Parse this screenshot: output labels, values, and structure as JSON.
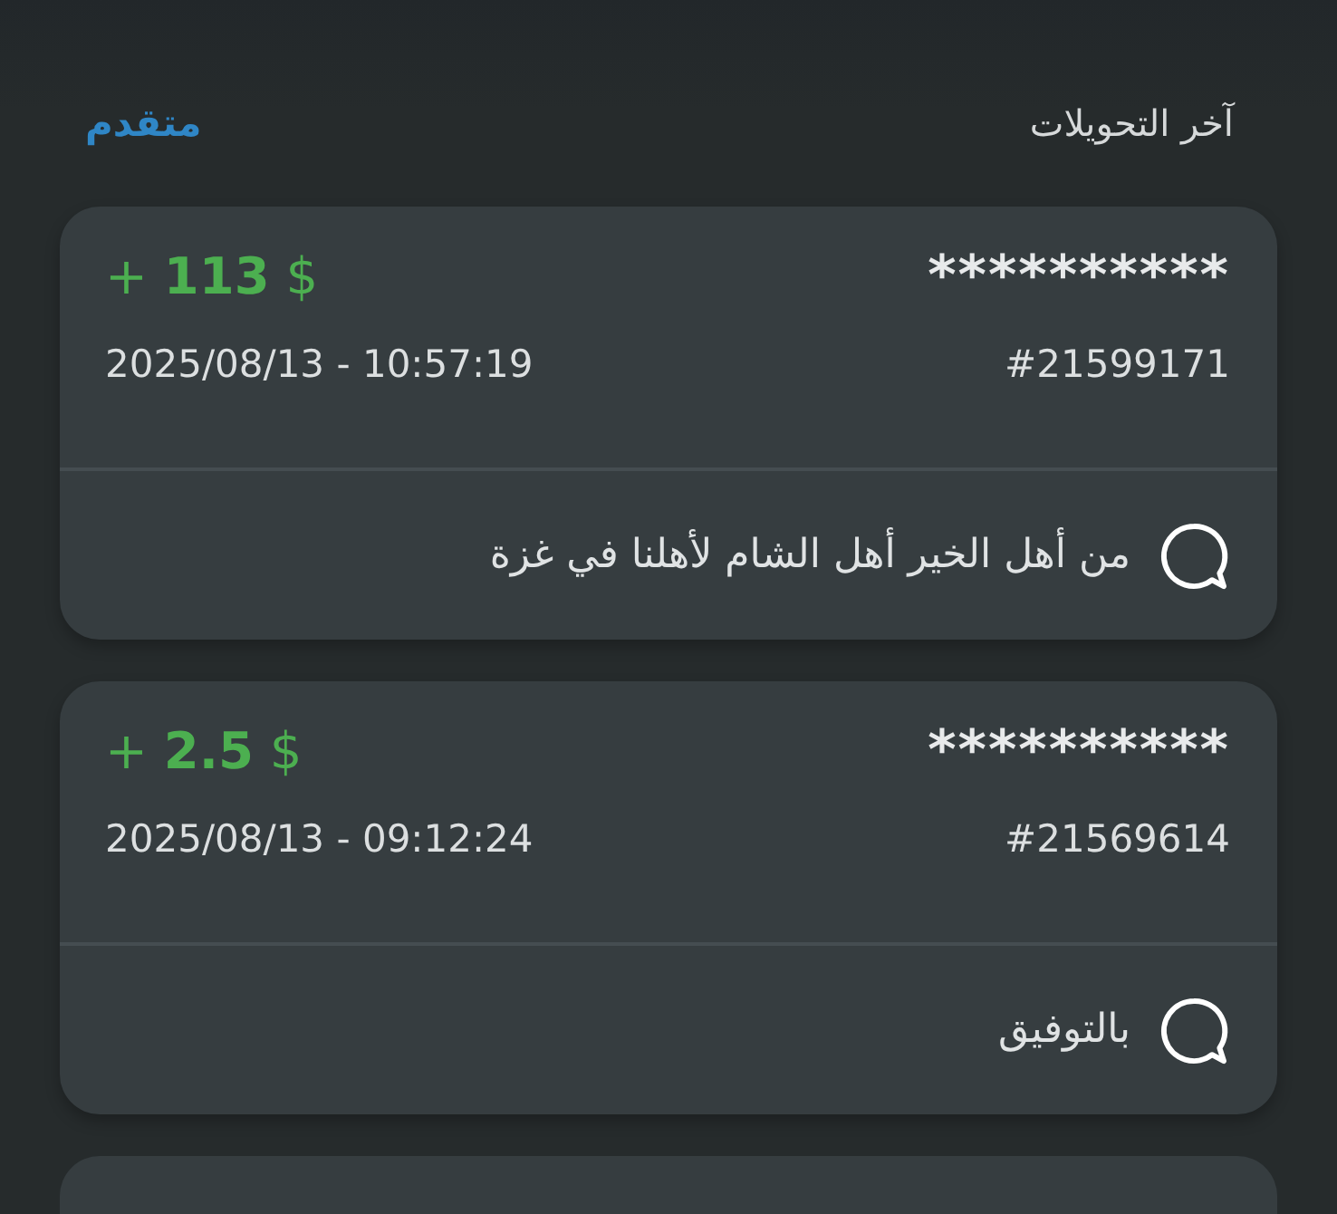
{
  "header": {
    "title": "آخر التحويلات",
    "link": "متقدم"
  },
  "transfers": [
    {
      "name": "**********",
      "amount": "+ **113** $",
      "id": "#21599171",
      "datetime": "2025/08/13 - 10:57:19",
      "message": "من أهل الخير أهل الشام لأهلنا في غزة"
    },
    {
      "name": "**********",
      "amount": "+ **2.5** $",
      "id": "#21569614",
      "datetime": "2025/08/13 - 09:12:24",
      "message": "بالتوفيق"
    }
  ]
}
